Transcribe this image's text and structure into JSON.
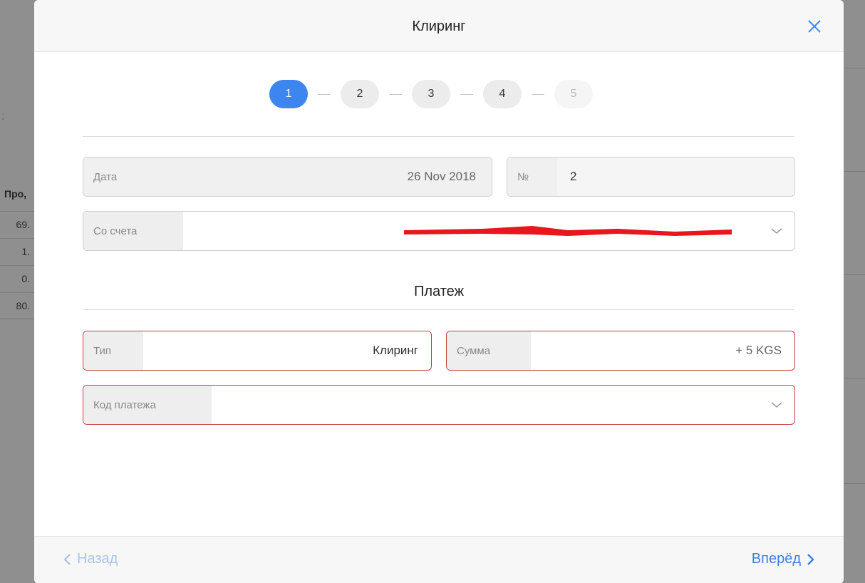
{
  "background": {
    "left_rows": [
      "69.",
      "1.",
      "0.",
      "80."
    ],
    "left_header": "Про,"
  },
  "modal": {
    "title": "Клиринг",
    "stepper": {
      "steps": [
        "1",
        "2",
        "3",
        "4",
        "5"
      ],
      "active_step": "1",
      "disabled_step": "5"
    },
    "date": {
      "label": "Дата",
      "value": "26 Nov 2018"
    },
    "number": {
      "label": "№",
      "value": "2"
    },
    "from_account": {
      "label": "Со счета",
      "value": ""
    },
    "payment_section_title": "Платеж",
    "type": {
      "label": "Тип",
      "value": "Клиринг"
    },
    "amount": {
      "label": "Сумма",
      "value": "+ 5 KGS"
    },
    "payment_code": {
      "label": "Код платежа",
      "value": ""
    },
    "footer": {
      "back_label": "Назад",
      "next_label": "Вперёд"
    }
  },
  "colors": {
    "accent": "#3d86f0",
    "error_border": "#c64045",
    "redaction": "#e8161d"
  }
}
